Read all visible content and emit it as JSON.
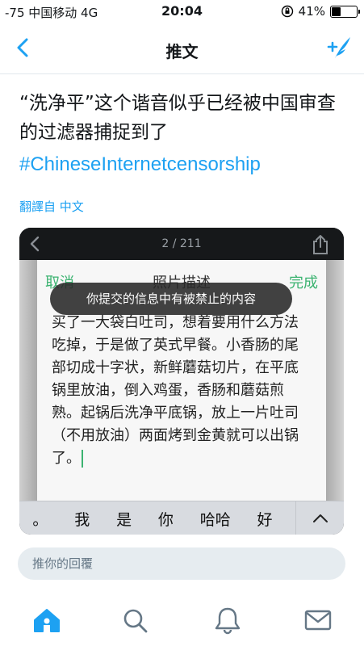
{
  "status_bar": {
    "carrier": "-75 中国移动  4G",
    "time": "20:04",
    "battery": "41%",
    "battery_level": 0.41
  },
  "nav": {
    "title": "推文",
    "back_icon": "chevron-left-icon",
    "compose_icon": "compose-tweet-icon"
  },
  "tweet": {
    "text": "“洗净平”这个谐音似乎已经被中国审查的过滤器捕捉到了",
    "hashtag": "#ChineseInternetcensorship",
    "translated_label": "翻譯自 中文"
  },
  "media": {
    "counter": "2 / 211",
    "cancel": "取消",
    "sheet_title": "照片描述",
    "done": "完成",
    "toast": "你提交的信息中有被禁止的内容",
    "body_text": "买了一大袋白吐司，想着要用什么方法吃掉，于是做了英式早餐。小香肠的尾部切成十字状，新鲜蘑菇切片，在平底锅里放油，倒入鸡蛋，香肠和蘑菇煎熟。起锅后洗净平底锅，放上一片吐司（不用放油）两面烤到金黄就可以出锅了。",
    "suggestions": [
      "。",
      "我",
      "是",
      "你",
      "哈哈",
      "好"
    ]
  },
  "reply": {
    "placeholder": "推你的回覆"
  },
  "colors": {
    "accent": "#1da1f2",
    "wechat_green": "#3cb371"
  }
}
